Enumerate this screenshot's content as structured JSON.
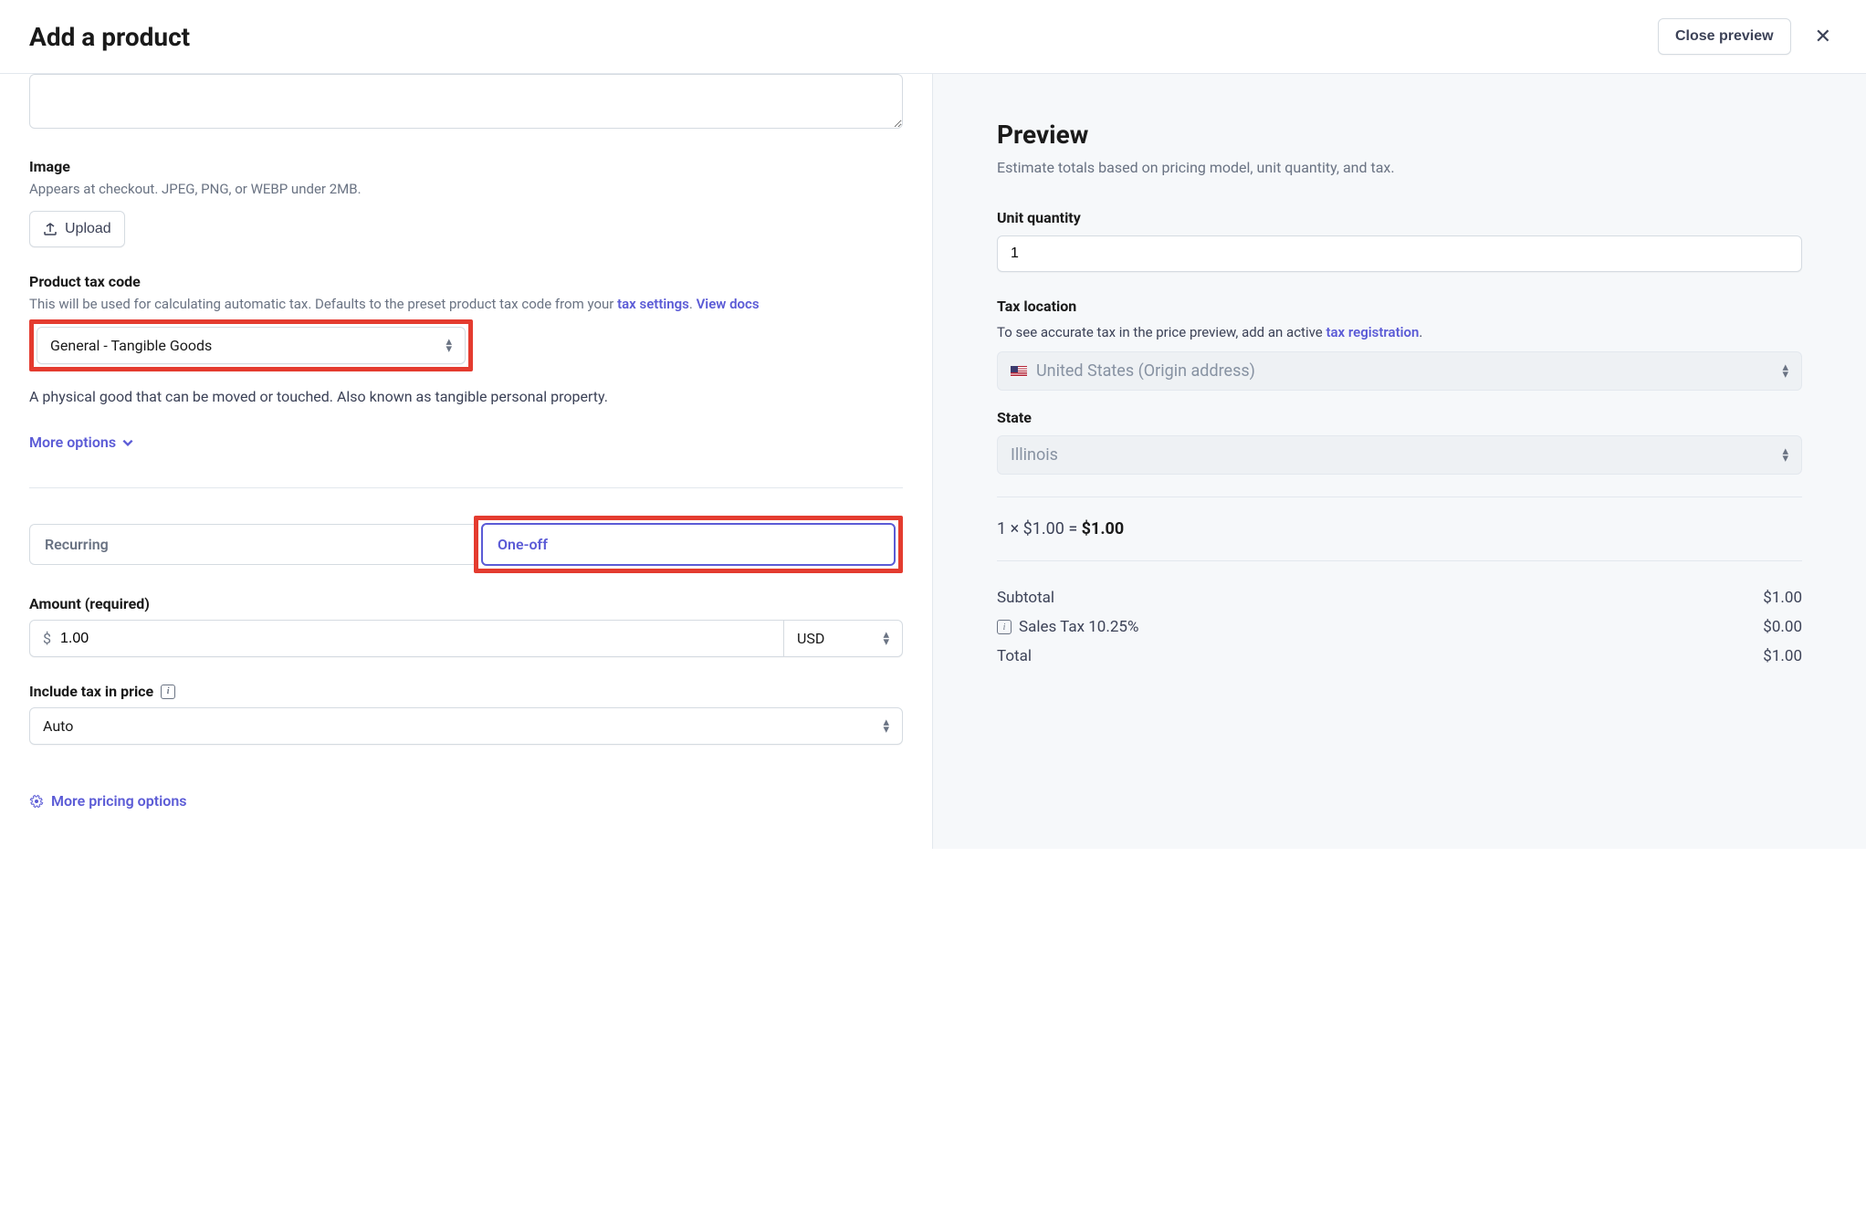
{
  "header": {
    "title": "Add a product",
    "close_preview_label": "Close preview"
  },
  "form": {
    "image": {
      "label": "Image",
      "help": "Appears at checkout. JPEG, PNG, or WEBP under 2MB.",
      "upload_label": "Upload"
    },
    "tax_code": {
      "label": "Product tax code",
      "help_prefix": "This will be used for calculating automatic tax. Defaults to the preset product tax code from your ",
      "help_link1": "tax settings",
      "help_sep": ". ",
      "help_link2": "View docs",
      "selected": "General - Tangible Goods",
      "description": "A physical good that can be moved or touched. Also known as tangible personal property."
    },
    "more_options_label": "More options",
    "pricing_tabs": {
      "recurring": "Recurring",
      "one_off": "One-off"
    },
    "amount": {
      "label": "Amount (required)",
      "symbol": "$",
      "value": "1.00",
      "currency": "USD"
    },
    "include_tax": {
      "label": "Include tax in price",
      "value": "Auto"
    },
    "more_pricing_label": "More pricing options"
  },
  "preview": {
    "title": "Preview",
    "description": "Estimate totals based on pricing model, unit quantity, and tax.",
    "unit_qty_label": "Unit quantity",
    "unit_qty_value": "1",
    "tax_location_label": "Tax location",
    "tax_location_help_prefix": "To see accurate tax in the price preview, add an active ",
    "tax_location_link": "tax registration",
    "tax_location_period": ".",
    "country": "United States (Origin address)",
    "state_label": "State",
    "state_value": "Illinois",
    "calc_prefix": "1 × $1.00 = ",
    "calc_result": "$1.00",
    "subtotal_label": "Subtotal",
    "subtotal_value": "$1.00",
    "sales_tax_label": "Sales Tax 10.25%",
    "sales_tax_value": "$0.00",
    "total_label": "Total",
    "total_value": "$1.00"
  }
}
